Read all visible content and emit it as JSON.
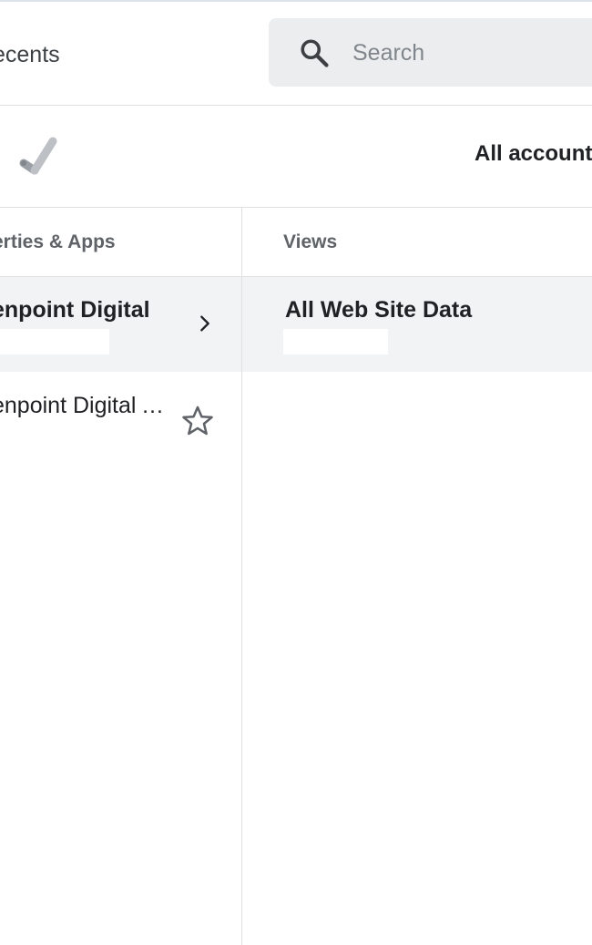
{
  "header": {
    "recents_label": "ecents",
    "search": {
      "placeholder": "Search"
    }
  },
  "breadcrumb": {
    "all_accounts_label": "All account"
  },
  "columns": {
    "properties_header": "erties & Apps",
    "views_header": "Views"
  },
  "properties": [
    {
      "label": "enpoint Digital",
      "selected": true
    },
    {
      "label": "enpoint Digital Associates",
      "selected": false
    }
  ],
  "views": [
    {
      "label": "All Web Site Data",
      "selected": true
    }
  ],
  "icons": {
    "search": "search-icon",
    "logo": "analytics-logo-icon",
    "chevron": "chevron-right-icon",
    "star": "star-outline-icon"
  },
  "colors": {
    "selected_row": "#f1f3f4",
    "search_bg": "#ebedef",
    "divider": "#e0e0e0"
  }
}
